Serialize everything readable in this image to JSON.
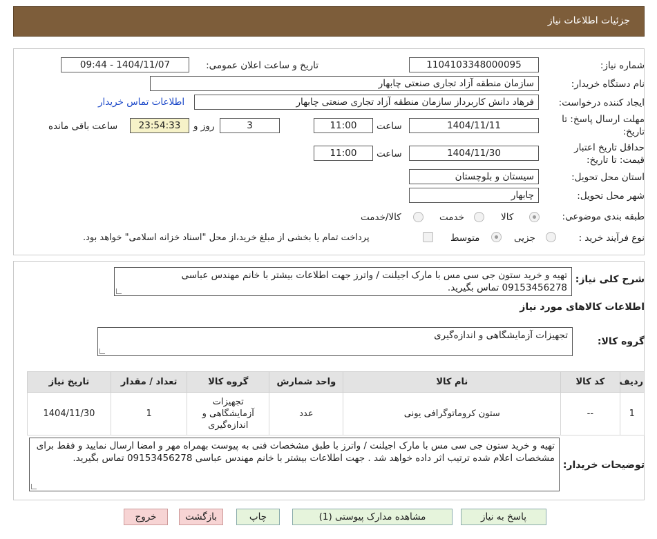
{
  "header": {
    "title": "جزئیات اطلاعات نیاز"
  },
  "form": {
    "need_number_label": "شماره نیاز:",
    "need_number": "1104103348000095",
    "announce_label": "تاریخ و ساعت اعلان عمومی:",
    "announce_value": "1404/11/07 - 09:44",
    "buyer_org_label": "نام دستگاه خریدار:",
    "buyer_org": "سازمان منطقه آزاد تجاری صنعتی چابهار",
    "creator_label": "ایجاد کننده درخواست:",
    "creator": "فرهاد دانش کاربرداز سازمان منطقه آزاد تجاری صنعتی چابهار",
    "contact_link": "اطلاعات تماس خریدار",
    "reply_deadline_label_1": "مهلت ارسال پاسخ: تا",
    "reply_deadline_label_2": "تاریخ:",
    "reply_date": "1404/11/11",
    "time_label": "ساعت",
    "reply_time": "11:00",
    "days_value": "3",
    "days_label": "روز و",
    "remaining_time": "23:54:33",
    "remaining_label": "ساعت باقی مانده",
    "price_validity_label_1": "حداقل تاریخ اعتبار",
    "price_validity_label_2": "قیمت: تا تاریخ:",
    "validity_date": "1404/11/30",
    "validity_time": "11:00",
    "province_label": "استان محل تحویل:",
    "province": "سیستان و بلوچستان",
    "city_label": "شهر محل تحویل:",
    "city": "چابهار",
    "category_label": "طبقه بندی موضوعی:",
    "category_options": [
      "کالا",
      "خدمت",
      "کالا/خدمت"
    ],
    "process_label": "نوع فرآیند خرید :",
    "process_options": [
      "جزیی",
      "متوسط"
    ],
    "payment_note": "پرداخت تمام یا بخشی از مبلغ خرید،از محل \"اسناد خزانه اسلامی\" خواهد بود."
  },
  "description": {
    "label": "شرح کلی نیاز:",
    "text": "تهیه و خرید ستون جی سی مس با مارک اجیلنت / واترز جهت اطلاعات بیشتر با خانم مهندس عباسی 09153456278 تماس بگیرید."
  },
  "goods": {
    "section_title": "اطلاعات کالاهای مورد نیاز",
    "group_label": "گروه کالا:",
    "group_value": "تجهیزات آزمایشگاهی و اندازه‌گیری",
    "columns": [
      "ردیف",
      "کد کالا",
      "نام کالا",
      "واحد شمارش",
      "گروه کالا",
      "تعداد / مقدار",
      "تاریخ نیاز"
    ],
    "rows": [
      [
        "1",
        "--",
        "ستون کروماتوگرافی یونی",
        "عدد",
        "تجهیزات آزمایشگاهی و اندازه‌گیری",
        "1",
        "1404/11/30"
      ]
    ]
  },
  "buyer_notes": {
    "label": "توضیحات خریدار:",
    "text": "تهیه و خرید ستون جی سی مس با مارک اجیلنت / واترز با طبق مشخصات فنی به پیوست بهمراه مهر و امضا ارسال نمایید و فقط برای مشخصات اعلام شده ترتیب اثر داده خواهد شد . جهت اطلاعات بیشتر با خانم مهندس عباسی 09153456278 تماس بگیرید."
  },
  "buttons": {
    "reply": "پاسخ به نیاز",
    "attachments": "مشاهده مدارک پیوستی (1)",
    "print": "چاپ",
    "back": "بازگشت",
    "exit": "خروج"
  },
  "colors": {
    "header_bg": "#7d5d3a",
    "link": "#1a47c8",
    "button_green": "#e6f4dc",
    "button_pink": "#f7d4d4",
    "remaining_bg": "#f6f2c8"
  }
}
